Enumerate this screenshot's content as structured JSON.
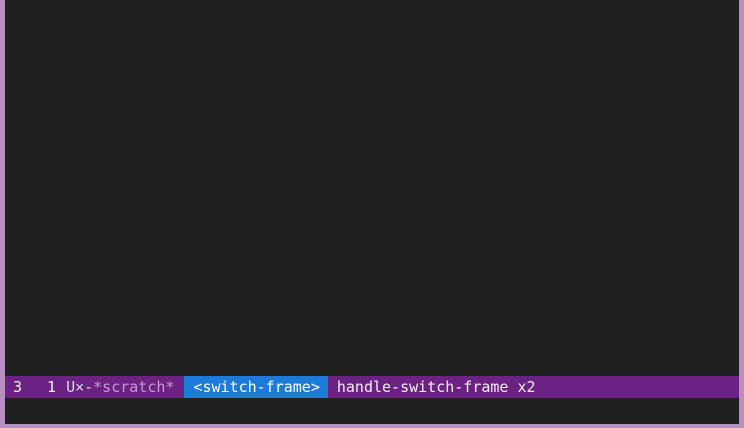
{
  "modeline": {
    "line_number": "3",
    "column_number": "1",
    "status_flags": "U×-",
    "buffer_name": "*scratch*",
    "last_key": "<switch-frame>",
    "last_command": "handle-switch-frame x2"
  },
  "colors": {
    "frame_border": "#b58fc0",
    "background": "#202020",
    "modeline_background": "#6b2283",
    "key_highlight": "#1c7ad8",
    "buffer_name": "#c79ad6"
  },
  "echo_area": {
    "text": ""
  }
}
